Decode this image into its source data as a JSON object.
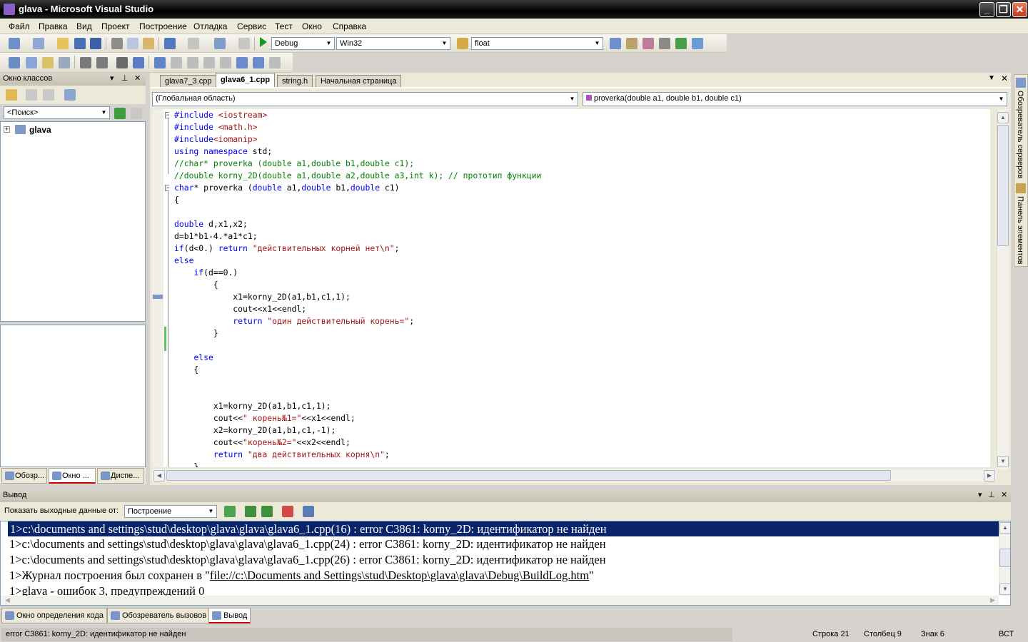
{
  "window": {
    "title": "glava - Microsoft Visual Studio"
  },
  "menu": [
    "Файл",
    "Правка",
    "Вид",
    "Проект",
    "Построение",
    "Отладка",
    "Сервис",
    "Тест",
    "Окно",
    "Справка"
  ],
  "toolbar": {
    "config": "Debug",
    "platform": "Win32",
    "find": "float"
  },
  "class_view": {
    "title": "Окно классов",
    "search_value": "<Поиск>",
    "tree_root": "glava",
    "tabs": [
      "Обозр...",
      "Окно ...",
      "Диспе..."
    ]
  },
  "editor": {
    "tabs": [
      "glava7_3.cpp",
      "glava6_1.cpp",
      "string.h",
      "Начальная страница"
    ],
    "scope_left": "(Глобальная область)",
    "scope_right": "proverka(double a1, double b1, double c1)"
  },
  "code_lines": [
    [
      [
        "pp",
        "#include "
      ],
      [
        "str",
        "<iostream>"
      ]
    ],
    [
      [
        "pp",
        "#include "
      ],
      [
        "str",
        "<math.h>"
      ]
    ],
    [
      [
        "pp",
        "#include"
      ],
      [
        "str",
        "<iomanip>"
      ]
    ],
    [
      [
        "kw",
        "using namespace "
      ],
      [
        "t",
        "std;"
      ]
    ],
    [
      [
        "cm",
        "//char* proverka (double a1,double b1,double c1);"
      ]
    ],
    [
      [
        "cm",
        "//double korny_2D(double a1,double a2,double a3,int k); // прототип функции"
      ]
    ],
    [
      [
        "kw",
        "char"
      ],
      [
        "t",
        "* proverka ("
      ],
      [
        "kw",
        "double"
      ],
      [
        "t",
        " a1,"
      ],
      [
        "kw",
        "double"
      ],
      [
        "t",
        " b1,"
      ],
      [
        "kw",
        "double"
      ],
      [
        "t",
        " c1)"
      ]
    ],
    [
      [
        "t",
        "{"
      ]
    ],
    [
      [
        "t",
        ""
      ]
    ],
    [
      [
        "kw",
        "double"
      ],
      [
        "t",
        " d,x1,x2;"
      ]
    ],
    [
      [
        "t",
        "d=b1*b1-4.*a1*c1;"
      ]
    ],
    [
      [
        "kw",
        "if"
      ],
      [
        "t",
        "(d<0.) "
      ],
      [
        "kw",
        "return "
      ],
      [
        "str",
        "\"действительных корней нет\\n\""
      ],
      [
        "t",
        ";"
      ]
    ],
    [
      [
        "kw",
        "else"
      ]
    ],
    [
      [
        "t",
        "    "
      ],
      [
        "kw",
        "if"
      ],
      [
        "t",
        "(d==0.)"
      ]
    ],
    [
      [
        "t",
        "        {"
      ]
    ],
    [
      [
        "t",
        "            x1=korny_2D(a1,b1,c1,1);"
      ]
    ],
    [
      [
        "t",
        "            cout<<x1<<endl;"
      ]
    ],
    [
      [
        "t",
        "            "
      ],
      [
        "kw",
        "return "
      ],
      [
        "str",
        "\"один действительный корень=\""
      ],
      [
        "t",
        ";"
      ]
    ],
    [
      [
        "t",
        "        }"
      ]
    ],
    [
      [
        "t",
        ""
      ]
    ],
    [
      [
        "t",
        "    "
      ],
      [
        "kw",
        "else"
      ]
    ],
    [
      [
        "t",
        "    {"
      ]
    ],
    [
      [
        "t",
        ""
      ]
    ],
    [
      [
        "t",
        ""
      ]
    ],
    [
      [
        "t",
        "        x1=korny_2D(a1,b1,c1,1);"
      ]
    ],
    [
      [
        "t",
        "        cout<<"
      ],
      [
        "str",
        "\" корень№1=\""
      ],
      [
        "t",
        "<<x1<<endl;"
      ]
    ],
    [
      [
        "t",
        "        x2=korny_2D(a1,b1,c1,-1);"
      ]
    ],
    [
      [
        "t",
        "        cout<<"
      ],
      [
        "str",
        "\"корень№2=\""
      ],
      [
        "t",
        "<<x2<<endl;"
      ]
    ],
    [
      [
        "t",
        "        "
      ],
      [
        "kw",
        "return "
      ],
      [
        "str",
        "\"два действительных корня\\n\""
      ],
      [
        "t",
        ";"
      ]
    ],
    [
      [
        "t",
        "    }"
      ]
    ],
    [
      [
        "t",
        "}"
      ]
    ]
  ],
  "output": {
    "title": "Вывод",
    "show_from_label": "Показать выходные данные от:",
    "show_from_value": "Построение",
    "lines": [
      "1>c:\\documents and settings\\stud\\desktop\\glava\\glava\\glava6_1.cpp(16) : error C3861: korny_2D: идентификатор не найден",
      "1>c:\\documents and settings\\stud\\desktop\\glava\\glava\\glava6_1.cpp(24) : error C3861: korny_2D: идентификатор не найден",
      "1>c:\\documents and settings\\stud\\desktop\\glava\\glava\\glava6_1.cpp(26) : error C3861: korny_2D: идентификатор не найден",
      "1>glava - ошибок 3, предупреждений 0"
    ],
    "log_prefix": "1>Журнал построения был сохранен в \"",
    "log_link": "file://c:\\Documents and Settings\\stud\\Desktop\\glava\\glava\\Debug\\BuildLog.htm",
    "log_suffix": "\""
  },
  "bottom_tabs": [
    "Окно определения кода",
    "Обозреватель вызовов",
    "Вывод"
  ],
  "right_tabs": [
    "Обозреватель серверов",
    "Панель элементов"
  ],
  "status": {
    "message": "error C3861: korny_2D: идентификатор не найден",
    "line": "Строка 21",
    "col": "Столбец 9",
    "char": "Знак 6",
    "mode": "ВСТ"
  }
}
